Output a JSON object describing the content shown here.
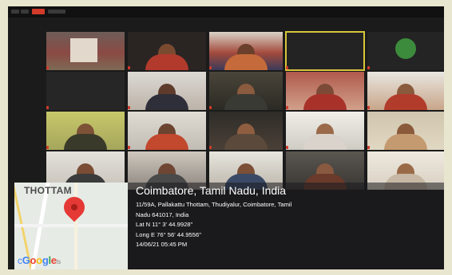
{
  "top_bar": {
    "record_indicator_color": "#d23a2a"
  },
  "geotag": {
    "map_area_label": "THOTTAM",
    "map_logo_text": "Google",
    "map_logo_suffix": "ls",
    "city_line": "Coimbatore, Tamil Nadu, India",
    "address_line1": "11/59A, Pallakattu Thottam, Thudiyalur, Coimbatore, Tamil",
    "address_line2": "Nadu 641017, India",
    "latitude": "Lat N 11° 3' 44.9928\"",
    "longitude": "Long E 76° 56' 44.9556\"",
    "timestamp": "14/06/21 05:45 PM"
  }
}
